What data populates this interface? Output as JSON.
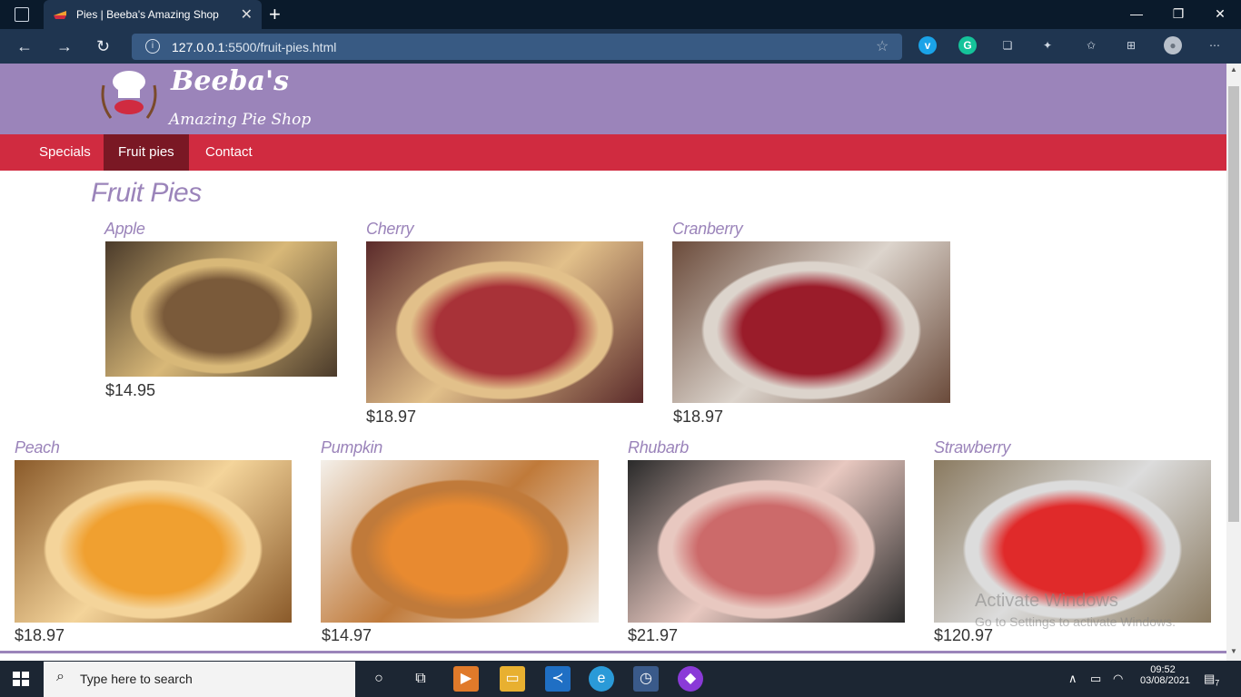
{
  "browser": {
    "tab_title": "Pies | Beeba's Amazing Shop",
    "tab_close": "✕",
    "new_tab": "+",
    "url_host": "127.0.0.1",
    "url_path": ":5500/fruit-pies.html",
    "window_controls": {
      "minimize": "—",
      "restore": "❐",
      "close": "✕"
    }
  },
  "site": {
    "brand_name": "Beeba's",
    "brand_tagline": "Amazing Pie Shop",
    "nav": [
      {
        "label": "Specials",
        "active": false
      },
      {
        "label": "Fruit pies",
        "active": true
      },
      {
        "label": "Contact",
        "active": false
      }
    ],
    "page_title": "Fruit Pies",
    "pies": [
      {
        "name": "Apple",
        "price": "$14.95",
        "colors": [
          "#7a5a3a",
          "#d8b878",
          "#4a3a2a"
        ]
      },
      {
        "name": "Cherry",
        "price": "$18.97",
        "colors": [
          "#a83238",
          "#e2c08a",
          "#5a2a2a"
        ]
      },
      {
        "name": "Cranberry",
        "price": "$18.97",
        "colors": [
          "#9a1c2a",
          "#dcd4cc",
          "#6a4a3a"
        ]
      },
      {
        "name": "Peach",
        "price": "$18.97",
        "colors": [
          "#f0a030",
          "#f4d49a",
          "#8a5a2a"
        ]
      },
      {
        "name": "Pumpkin",
        "price": "$14.97",
        "colors": [
          "#e88a30",
          "#c07a3a",
          "#f4f0ea"
        ]
      },
      {
        "name": "Rhubarb",
        "price": "$21.97",
        "colors": [
          "#cc6a6a",
          "#e8c8c0",
          "#2a2a2a"
        ]
      },
      {
        "name": "Strawberry",
        "price": "$120.97",
        "colors": [
          "#e02a2a",
          "#dcdcdc",
          "#8a7a60"
        ]
      }
    ]
  },
  "watermark": {
    "line1": "Activate Windows",
    "line2": "Go to Settings to activate Windows."
  },
  "taskbar": {
    "search_placeholder": "Type here to search",
    "time": "09:52",
    "date": "03/08/2021",
    "notification_count": "7"
  },
  "colors": {
    "header": "#9b84ba",
    "nav": "#d02b40",
    "nav_active": "#7a1824",
    "accent_text": "#9b84ba"
  }
}
